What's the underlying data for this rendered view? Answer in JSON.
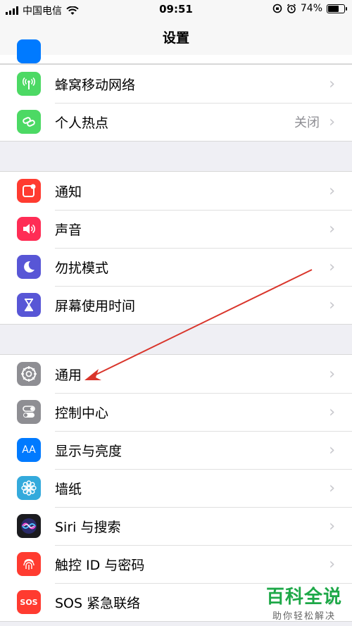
{
  "status_bar": {
    "carrier": "中国电信",
    "time": "09:51",
    "battery": "74%",
    "battery_fraction": 0.74
  },
  "nav": {
    "title": "设置"
  },
  "groups": {
    "connectivity": [
      {
        "label": "蜂窝移动网络",
        "icon": "antenna-icon"
      },
      {
        "label": "个人热点",
        "value": "关闭",
        "icon": "hotspot-link-icon"
      }
    ],
    "alerts": [
      {
        "label": "通知",
        "icon": "notification-icon"
      },
      {
        "label": "声音",
        "icon": "speaker-icon"
      },
      {
        "label": "勿扰模式",
        "icon": "moon-icon"
      },
      {
        "label": "屏幕使用时间",
        "icon": "hourglass-icon"
      }
    ],
    "general": [
      {
        "label": "通用",
        "icon": "gear-icon"
      },
      {
        "label": "控制中心",
        "icon": "toggles-icon"
      },
      {
        "label": "显示与亮度",
        "icon": "text-size-icon",
        "glyph": "AA"
      },
      {
        "label": "墙纸",
        "icon": "flower-icon"
      },
      {
        "label": "Siri 与搜索",
        "icon": "siri-icon"
      },
      {
        "label": "触控 ID 与密码",
        "icon": "fingerprint-icon"
      },
      {
        "label": "SOS 紧急联络",
        "icon": "sos-icon",
        "glyph": "SOS"
      }
    ]
  },
  "watermark": {
    "title": "百科全说",
    "subtitle": "助你轻松解决"
  },
  "colors": {
    "accent_green": "#4cd964",
    "arrow": "#d9352b",
    "watermark_green": "#1ea848"
  }
}
